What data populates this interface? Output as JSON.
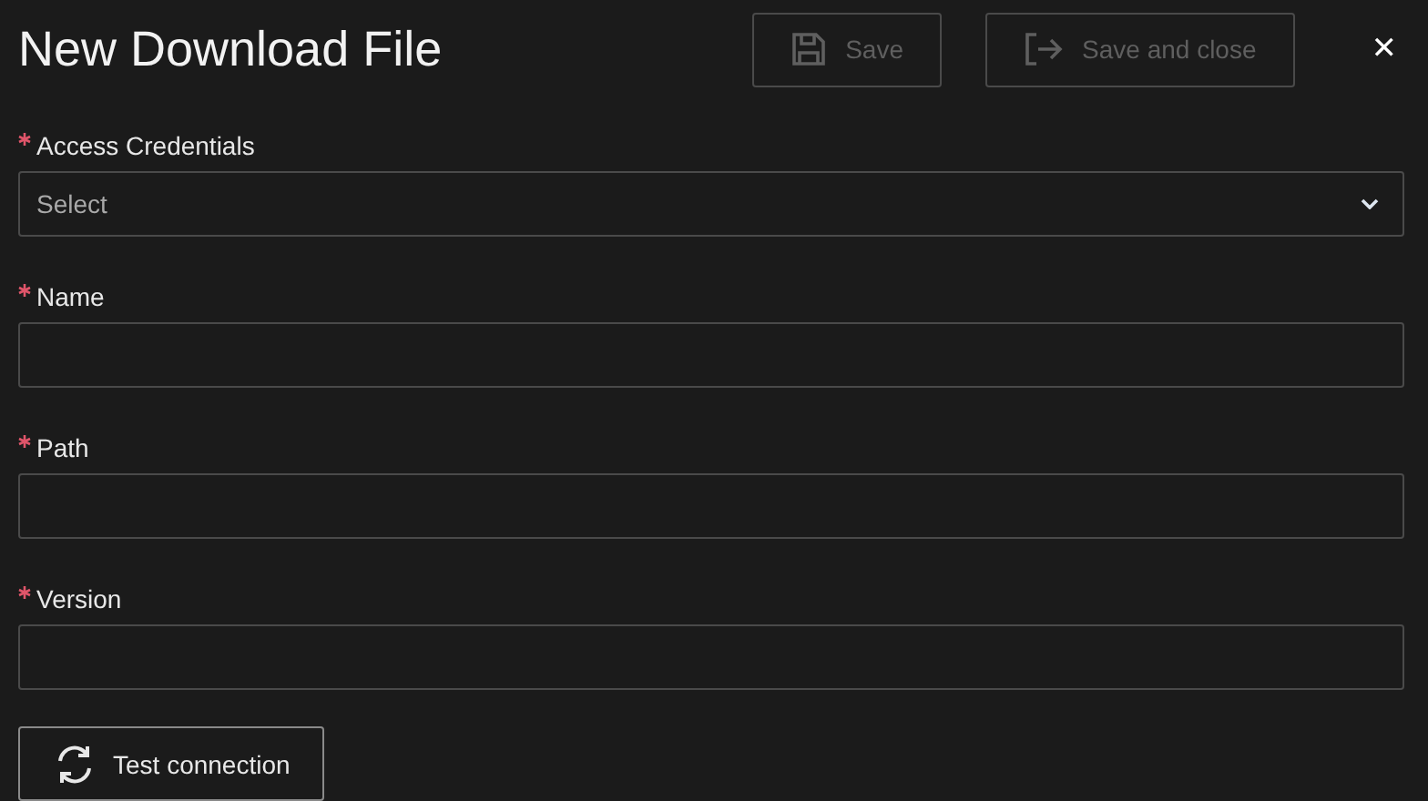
{
  "window": {
    "title": "New Download File"
  },
  "toolbar": [
    {
      "kind": "save",
      "label": "Save",
      "disabled": true
    },
    {
      "kind": "exit",
      "label": "Save and close",
      "disabled": true
    }
  ],
  "close": "✕",
  "fields": [
    {
      "kind": "select",
      "label": "Access Credentials",
      "required": true,
      "placeholder": "Select"
    },
    {
      "kind": "text",
      "label": "Name",
      "required": true
    },
    {
      "kind": "text",
      "label": "Path",
      "required": true
    },
    {
      "kind": "text",
      "label": "Version",
      "required": true
    }
  ],
  "test_button": {
    "label": "Test connection"
  }
}
